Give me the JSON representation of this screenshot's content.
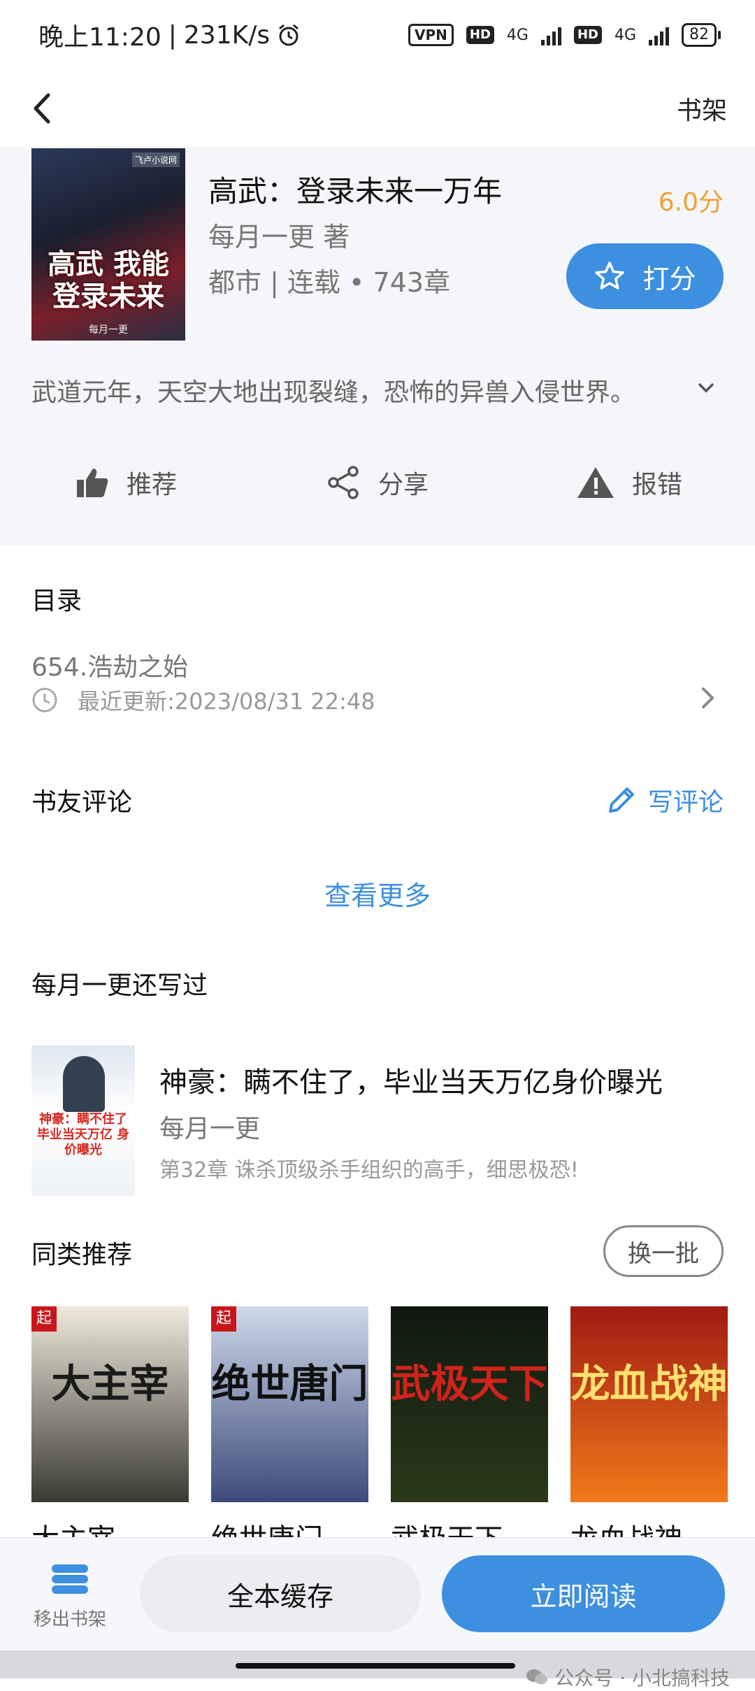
{
  "status_bar": {
    "time": "晚上11:20",
    "speed": "231K/s",
    "vpn": "VPN",
    "hd": "HD",
    "net": "4G",
    "battery": "82"
  },
  "nav": {
    "right_label": "书架"
  },
  "book": {
    "title": "高武：登录未来一万年",
    "rating": "6.0分",
    "author": "每月一更 著",
    "meta": "都市 | 连载 • 743章",
    "rate_label": "打分",
    "description": "武道元年，天空大地出现裂缝，恐怖的异兽入侵世界。",
    "cover_text": "高武 我能登录未来",
    "cover_author": "每月一更",
    "cover_badge": "飞卢小说网"
  },
  "actions": [
    {
      "label": "推荐",
      "icon": "thumbs-up-icon"
    },
    {
      "label": "分享",
      "icon": "share-icon"
    },
    {
      "label": "报错",
      "icon": "warning-icon"
    }
  ],
  "toc": {
    "title": "目录",
    "latest_chapter": "654.浩劫之始",
    "updated": "最近更新:2023/08/31 22:48"
  },
  "reviews": {
    "title": "书友评论",
    "write_label": "写评论",
    "see_more": "查看更多"
  },
  "author_books": {
    "title": "每月一更还写过",
    "book_title": "神豪：瞒不住了，毕业当天万亿身价曝光",
    "book_author": "每月一更",
    "book_chapter": "第32章 诛杀顶级杀手组织的高手，细思极恐!",
    "cover_text": "神豪：瞒不住了 毕业当天万亿 身价曝光"
  },
  "similar": {
    "title": "同类推荐",
    "refresh_label": "换一批",
    "books": [
      {
        "name": "大主宰",
        "cover_text": "大主宰",
        "color_top": "#efe9dc",
        "color_bottom": "#3a3a32",
        "text_color": "#1a1a1a"
      },
      {
        "name": "绝世唐门",
        "cover_text": "绝世唐门",
        "color_top": "#cfd9ea",
        "color_bottom": "#3b4a7a",
        "text_color": "#111111"
      },
      {
        "name": "武极天下",
        "cover_text": "武极天下",
        "color_top": "#101810",
        "color_bottom": "#2a3a1a",
        "text_color": "#d0231c"
      },
      {
        "name": "龙血战神",
        "cover_text": "龙血战神",
        "color_top": "#a11a12",
        "color_bottom": "#f07a1a",
        "text_color": "#ffe070"
      }
    ]
  },
  "bottom_bar": {
    "remove_label": "移出书架",
    "cache_label": "全本缓存",
    "read_label": "立即阅读"
  },
  "watermark": "公众号 · 小北搞科技",
  "colors": {
    "accent": "#3d8fe0",
    "rating": "#f0a030"
  }
}
